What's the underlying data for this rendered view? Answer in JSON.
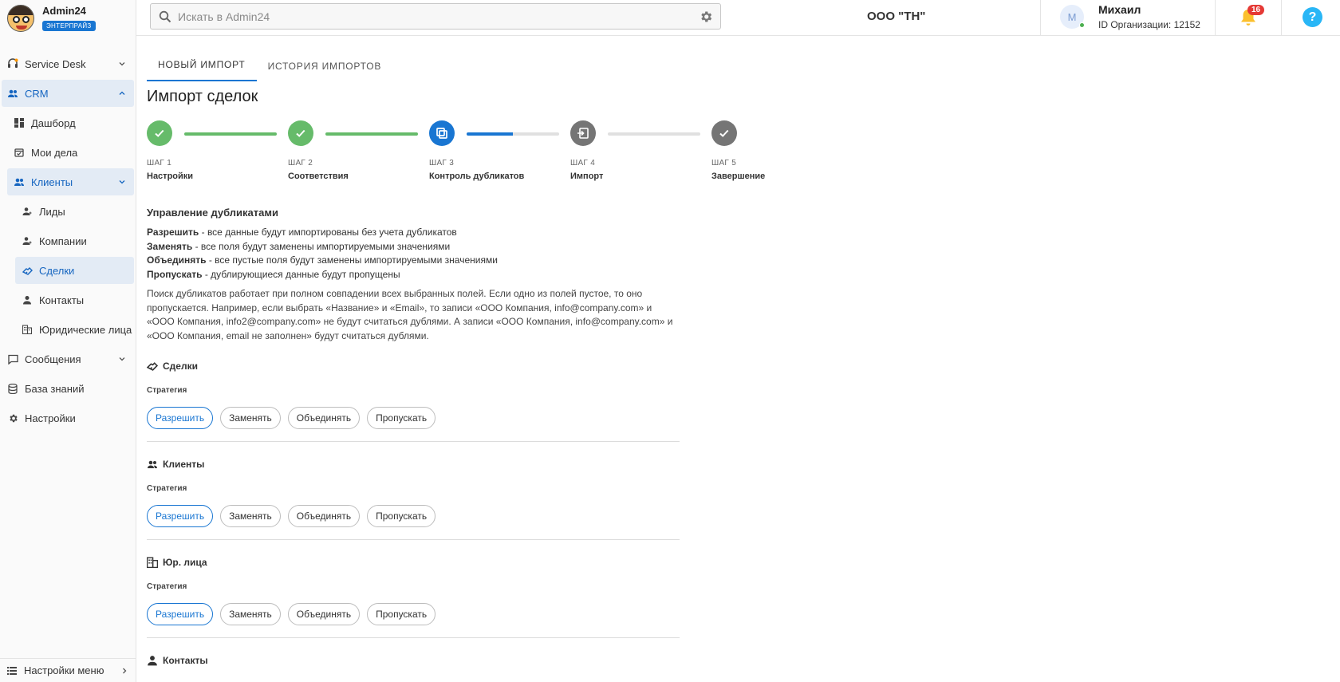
{
  "app": {
    "name": "Admin24",
    "badge": "ЭНТЕРПРАЙЗ"
  },
  "sidebar": {
    "items": [
      {
        "label": "Service Desk"
      },
      {
        "label": "CRM"
      },
      {
        "label": "Дашборд"
      },
      {
        "label": "Мои дела"
      },
      {
        "label": "Клиенты"
      },
      {
        "label": "Лиды"
      },
      {
        "label": "Компании"
      },
      {
        "label": "Сделки"
      },
      {
        "label": "Контакты"
      },
      {
        "label": "Юридические лица"
      },
      {
        "label": "Сообщения"
      },
      {
        "label": "База знаний"
      },
      {
        "label": "Настройки"
      }
    ],
    "footer": "Настройки меню"
  },
  "header": {
    "search_placeholder": "Искать в Admin24",
    "org": "ООО \"ТН\"",
    "user": {
      "initial": "М",
      "name": "Михаил",
      "org_id": "ID Организации: 12152"
    },
    "notifications": "16",
    "help": "?"
  },
  "tabs": [
    "НОВЫЙ ИМПОРТ",
    "ИСТОРИЯ ИМПОРТОВ"
  ],
  "page_title": "Импорт сделок",
  "stepper": {
    "steps": [
      {
        "num": "ШАГ 1",
        "name": "Настройки",
        "status": "done"
      },
      {
        "num": "ШАГ 2",
        "name": "Соответствия",
        "status": "done"
      },
      {
        "num": "ШАГ 3",
        "name": "Контроль дубликатов",
        "status": "current"
      },
      {
        "num": "ШАГ 4",
        "name": "Импорт",
        "status": "todo"
      },
      {
        "num": "ШАГ 5",
        "name": "Завершение",
        "status": "todo"
      }
    ],
    "progress": [
      1.0,
      1.0,
      0.5,
      0.0
    ]
  },
  "duplicates": {
    "title": "Управление дубликатами",
    "rules": [
      {
        "term": "Разрешить",
        "text": " - все данные будут импортированы без учета дубликатов"
      },
      {
        "term": "Заменять",
        "text": " - все поля будут заменены импортируемыми значениями"
      },
      {
        "term": "Объединять",
        "text": " - все пустые поля будут заменены импортируемыми значениями"
      },
      {
        "term": "Пропускать",
        "text": " - дублирующиеся данные будут пропущены"
      }
    ],
    "description": "Поиск дубликатов работает при полном совпадении всех выбранных полей. Если одно из полей пустое, то оно пропускается. Например, если выбрать «Название» и «Email», то записи «ООО Компания, info@company.com» и «ООО Компания, info2@company.com» не будут считаться дублями. А записи «ООО Компания, info@company.com» и «ООО Компания, email не заполнен» будут считаться дублями.",
    "strategy_label": "Стратегия",
    "options": [
      "Разрешить",
      "Заменять",
      "Объединять",
      "Пропускать"
    ],
    "groups": [
      {
        "title": "Сделки",
        "selected": "Разрешить"
      },
      {
        "title": "Клиенты",
        "selected": "Разрешить"
      },
      {
        "title": "Юр. лица",
        "selected": "Разрешить"
      },
      {
        "title": "Контакты",
        "selected": "Разрешить"
      }
    ]
  },
  "colors": {
    "accent": "#1976d2",
    "done": "#66bb6a",
    "todo": "#757575",
    "active_bg": "#e3ebf5"
  }
}
